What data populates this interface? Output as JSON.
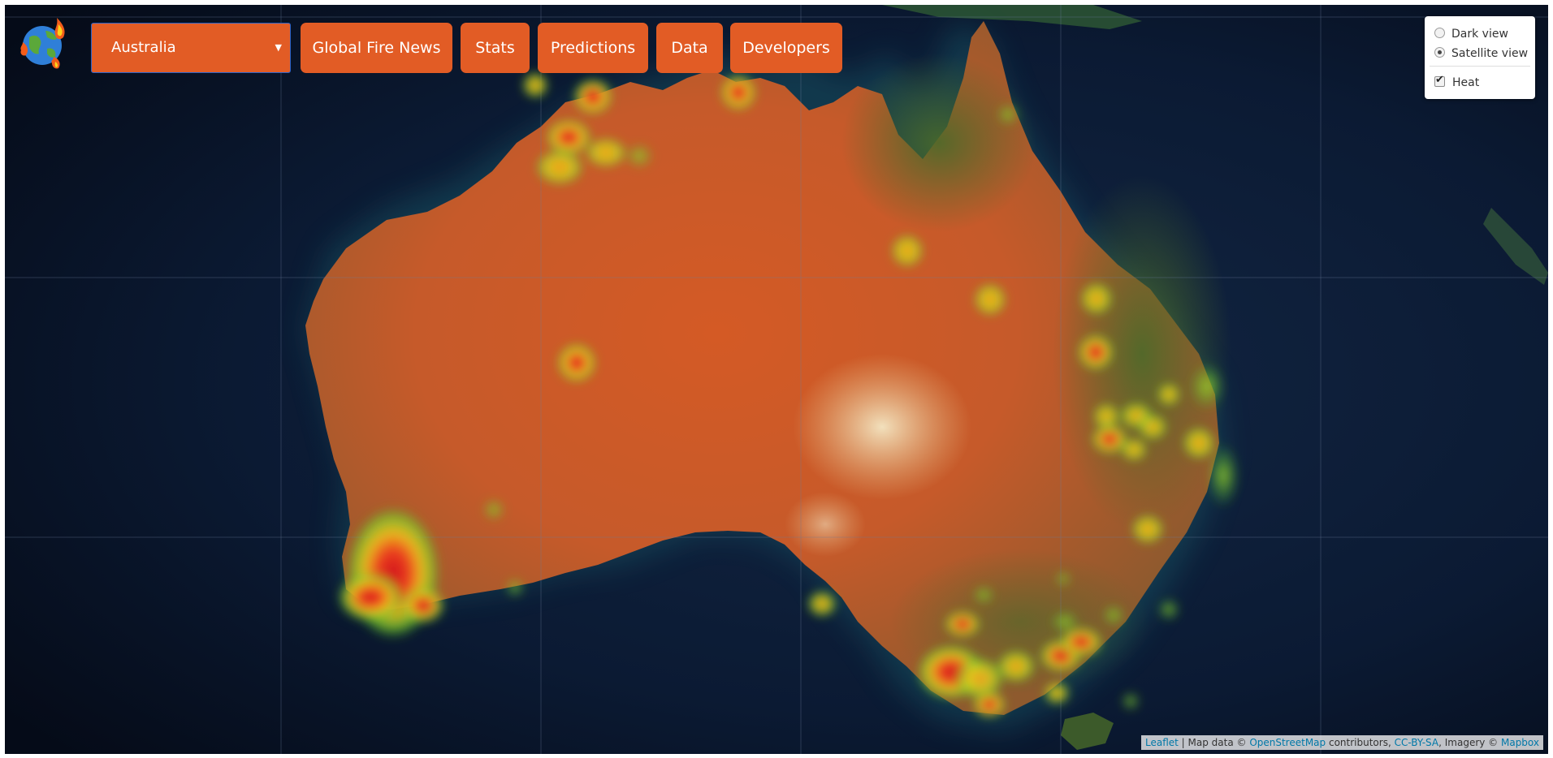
{
  "header": {
    "logo_icon": "globe-fire-logo-icon",
    "country_select": {
      "selected": "Australia",
      "caret": "▼"
    },
    "nav": [
      {
        "label": "Global Fire News"
      },
      {
        "label": "Stats"
      },
      {
        "label": "Predictions"
      },
      {
        "label": "Data"
      },
      {
        "label": "Developers"
      }
    ],
    "button_color": "#e25c25"
  },
  "layer_control": {
    "base_layers": [
      {
        "label": "Dark view",
        "checked": false
      },
      {
        "label": "Satellite view",
        "checked": true
      }
    ],
    "overlays": [
      {
        "label": "Heat",
        "checked": true
      }
    ]
  },
  "map": {
    "region": "Australia",
    "view": "Satellite view",
    "overlay": "Heat",
    "colors": {
      "ocean": "#0a1428",
      "land_desert": "#c8572a",
      "heat_low": "#7fd22a",
      "heat_mid": "#f2c21b",
      "heat_high": "#e0141a"
    }
  },
  "attribution": {
    "leaflet": "Leaflet",
    "sep": " | Map data © ",
    "osm": "OpenStreetMap",
    "contributors": " contributors, ",
    "license": "CC-BY-SA",
    "imagery": ", Imagery © ",
    "mapbox": "Mapbox"
  }
}
